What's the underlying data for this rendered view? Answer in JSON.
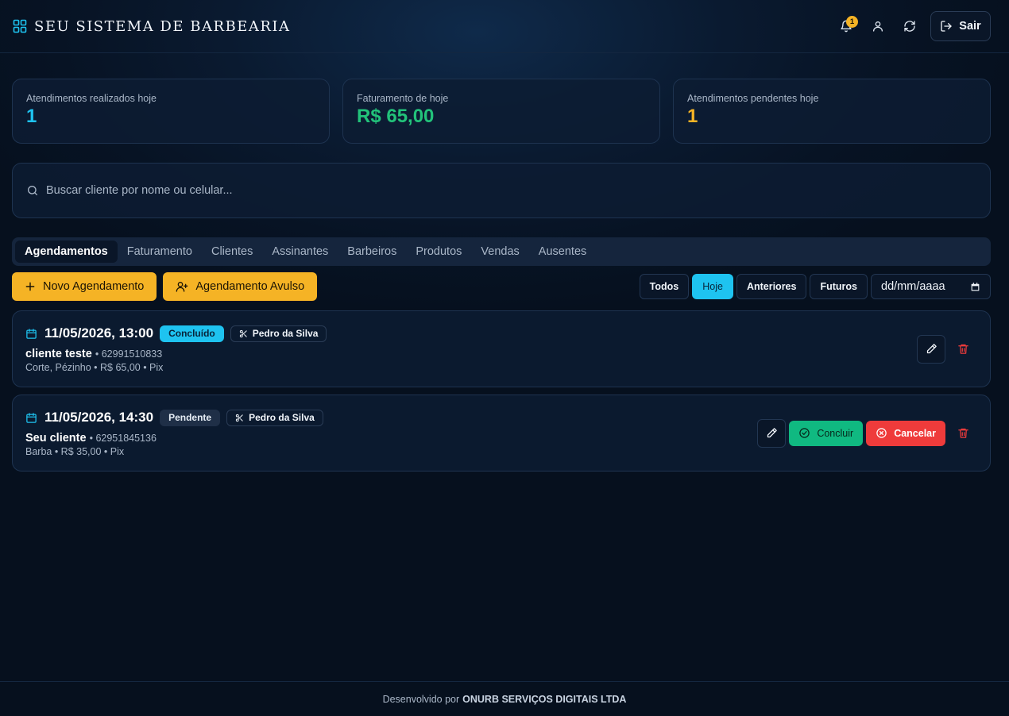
{
  "colors": {
    "accent_cyan": "#1ec3f0",
    "accent_yellow": "#f5b325",
    "success_green": "#10b981",
    "danger_red": "#ef3b3b",
    "revenue_green": "#22c27a",
    "pending_yellow": "#f5b325"
  },
  "header": {
    "title": "SEU SISTEMA DE BARBEARIA",
    "notification_count": "1",
    "logout_label": "Sair",
    "icons": [
      "grid-icon",
      "bell-icon",
      "user-icon",
      "refresh-icon",
      "logout-icon"
    ]
  },
  "stats": [
    {
      "label": "Atendimentos realizados hoje",
      "value": "1",
      "color": "#1ec3f0"
    },
    {
      "label": "Faturamento de hoje",
      "value": "R$ 65,00",
      "color": "#22c27a"
    },
    {
      "label": "Atendimentos pendentes hoje",
      "value": "1",
      "color": "#f5b325"
    }
  ],
  "search": {
    "placeholder": "Buscar cliente por nome ou celular...",
    "value": ""
  },
  "tabs": [
    "Agendamentos",
    "Faturamento",
    "Clientes",
    "Assinantes",
    "Barbeiros",
    "Produtos",
    "Vendas",
    "Ausentes"
  ],
  "active_tab": "Agendamentos",
  "toolbar": {
    "new_label": "Novo Agendamento",
    "walkin_label": "Agendamento Avulso",
    "filters": [
      "Todos",
      "Hoje",
      "Anteriores",
      "Futuros"
    ],
    "active_filter": "Hoje",
    "date_placeholder": "dd/mm/aaaa"
  },
  "appointments": [
    {
      "datetime": "11/05/2026, 13:00",
      "status": "Concluído",
      "barber": "Pedro da Silva",
      "client": "cliente teste",
      "phone": "• 62991510833",
      "details": "Corte, Pézinho • R$ 65,00 • Pix"
    },
    {
      "datetime": "11/05/2026, 14:30",
      "status": "Pendente",
      "barber": "Pedro da Silva",
      "client": "Seu cliente",
      "phone": "• 62951845136",
      "details": "Barba • R$ 35,00 • Pix",
      "complete_label": "Concluir",
      "cancel_label": "Cancelar"
    }
  ],
  "footer": {
    "prefix": "Desenvolvido por",
    "company": "ONURB SERVIÇOS DIGITAIS LTDA"
  }
}
